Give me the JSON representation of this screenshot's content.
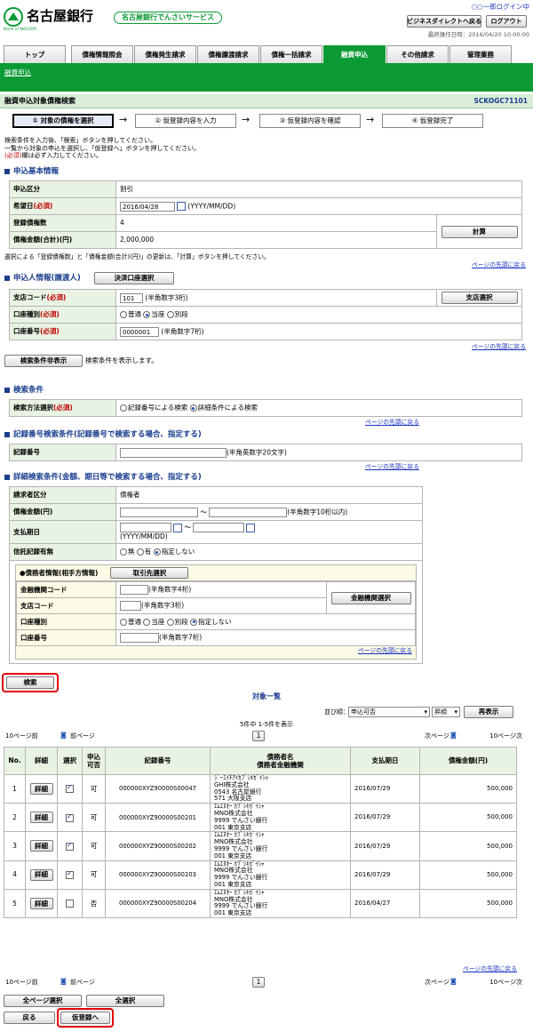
{
  "header": {
    "bank_name": "名古屋銀行",
    "bank_sub": "Bank of NAGOYA",
    "service_badge": "名古屋銀行でんさいサービス",
    "user": "○○一郎ログイン中",
    "btn_back": "ビジネスダイレクトへ戻る",
    "btn_logout": "ログアウト",
    "last_op": "最終操作日時：2016/04/20 10:00:00"
  },
  "tabs": [
    "トップ",
    "債権情報照会",
    "債権発生請求",
    "債権譲渡請求",
    "債権一括請求",
    "融資申込",
    "その他請求",
    "管理業務"
  ],
  "active_tab": 5,
  "subnav": "融資申込",
  "page": {
    "title": "融資申込対象債権検索",
    "code": "SCKOGC71101"
  },
  "steps": [
    "① 対象の債権を選択",
    "② 仮登録内容を入力",
    "③ 仮登録内容を確認",
    "④ 仮登録完了"
  ],
  "instructions": {
    "l1": "検索条件を入力後、「検索」ボタンを押してください。",
    "l2": "一覧から対象の申込を選択し、「仮登録へ」ボタンを押してください。",
    "l3_req": "(必須)",
    "l3_rest": "欄は必ず入力してください。"
  },
  "basic": {
    "heading": "申込基本情報",
    "kbn_label": "申込区分",
    "kbn_val": "割引",
    "date_label": "希望日",
    "req": "(必須)",
    "date_val": "2016/04/28",
    "date_fmt": "(YYYY/MM/DD)",
    "count_label": "登録債権数",
    "count_val": "4",
    "amt_label": "債権金額(合計)(円)",
    "amt_val": "2,000,000",
    "calc_btn": "計算",
    "note": "選択による「登録債権数」と「債権金額(合計)(円)」の更新は、「計算」ボタンを押してください。"
  },
  "top_link": "ページの先頭に戻る",
  "applicant": {
    "heading": "申込人情報(譲渡人)",
    "select_btn": "決済口座選択",
    "branch_label": "支店コード",
    "branch_val": "101",
    "branch_hint": "(半角数字3桁)",
    "branch_btn": "支店選択",
    "acct_type_label": "口座種別",
    "opts": [
      "普通",
      "当座",
      "別段"
    ],
    "acct_no_label": "口座番号",
    "acct_no_val": "0000001",
    "acct_no_hint": "(半角数字7桁)"
  },
  "toggle": {
    "btn": "検索条件非表示",
    "text": "検索条件を表示します。"
  },
  "search": {
    "heading": "検索条件",
    "method_label": "検索方法選択",
    "opts": [
      "記録番号による検索",
      "詳細条件による検索"
    ]
  },
  "recno": {
    "heading": "記録番号検索条件(記録番号で検索する場合、指定する)",
    "label": "記録番号",
    "hint": "(半角英数字20文字)"
  },
  "detail": {
    "heading": "詳細検索条件(金額、期日等で検索する場合、指定する)",
    "req_kbn_label": "請求者区分",
    "req_kbn_val": "債権者",
    "amt_label": "債権金額(円)",
    "amt_hint": "(半角数字10桁以内)",
    "due_label": "支払期日",
    "due_fmt": "(YYYY/MM/DD)",
    "rec_label": "信託記録有無",
    "rec_opts": [
      "無",
      "有",
      "指定しない"
    ],
    "debtor_heading": "●債務者情報(相手方情報)",
    "debtor_btn": "取引先選択",
    "fin_label": "金融機関コード",
    "fin_hint": "(半角数字4桁)",
    "fin_btn": "金融機関選択",
    "br_label": "支店コード",
    "br_hint": "(半角数字3桁)",
    "at_label": "口座種別",
    "at_opts": [
      "普通",
      "当座",
      "別段",
      "指定しない"
    ],
    "an_label": "口座番号",
    "an_hint": "(半角数字7桁)"
  },
  "search_btn": "検索",
  "list": {
    "title": "対象一覧",
    "sort_label": "並び順：",
    "sort_val": "申込可否",
    "order_val": "昇順",
    "resort_btn": "再表示",
    "count": "5件中 1-5件を表示",
    "prev10": "10ページ前",
    "prev": "前ページ",
    "page": "1",
    "next": "次ページ",
    "next10": "10ページ次",
    "headers": [
      "No.",
      "詳細",
      "選択",
      "申込可否",
      "記録番号",
      "債務者名\n債務者金融機関",
      "支払期日",
      "債権金額(円)"
    ],
    "detail_btn": "詳細",
    "rows": [
      {
        "no": "1",
        "chk": true,
        "ok": "可",
        "rec": "000000XYZ90000S00047",
        "l1": "ｼﾞｰｴｲﾁｱｲｶﾌﾞｼｷｶﾞｲｼｬ",
        "l2": "GHI株式会社",
        "l3": "0543 名古屋銀行",
        "l4": "571 大阪支店",
        "due": "2016/07/29",
        "amt": "500,000"
      },
      {
        "no": "2",
        "chk": true,
        "ok": "可",
        "rec": "000000XYZ90000S00201",
        "l1": "ｴﾑｴﾇｵｰ ｶﾌﾞｼｷｶﾞｲｼｬ",
        "l2": "MNO株式会社",
        "l3": "9999 でんさい銀行",
        "l4": "001 東京支店",
        "due": "2016/07/29",
        "amt": "500,000"
      },
      {
        "no": "3",
        "chk": true,
        "ok": "可",
        "rec": "000000XYZ90000S00202",
        "l1": "ｴﾑｴﾇｵｰ ｶﾌﾞｼｷｶﾞｲｼｬ",
        "l2": "MNO株式会社",
        "l3": "9999 でんさい銀行",
        "l4": "001 東京支店",
        "due": "2016/07/29",
        "amt": "500,000"
      },
      {
        "no": "4",
        "chk": true,
        "ok": "可",
        "rec": "000000XYZ90000S00203",
        "l1": "ｴﾑｴﾇｵｰ ｶﾌﾞｼｷｶﾞｲｼｬ",
        "l2": "MNO株式会社",
        "l3": "9999 でんさい銀行",
        "l4": "001 東京支店",
        "due": "2016/07/29",
        "amt": "500,000"
      },
      {
        "no": "5",
        "chk": false,
        "ok": "否",
        "rec": "000000XYZ90000S00204",
        "l1": "ｴﾑｴﾇｵｰ ｶﾌﾞｼｷｶﾞｲｼｬ",
        "l2": "MNO株式会社",
        "l3": "9999 でんさい銀行",
        "l4": "001 東京支店",
        "due": "2016/04/27",
        "amt": "500,000"
      }
    ]
  },
  "footer": {
    "all_page": "全ページ選択",
    "all": "全選択",
    "back": "戻る",
    "next": "仮登録へ"
  }
}
